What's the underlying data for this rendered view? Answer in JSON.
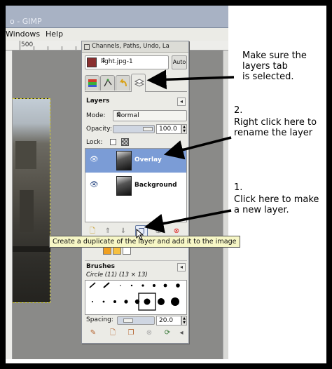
{
  "gimp_window": {
    "title": "o - GIMP",
    "menu": [
      "Windows",
      "Help"
    ],
    "ruler_mark": "500"
  },
  "dock": {
    "title": "Channels, Paths, Undo, La",
    "image_selector": "light.jpg-1",
    "auto_button": "Auto",
    "tabs": [
      "channels-tab",
      "paths-tab",
      "undo-tab",
      "layers-tab"
    ],
    "active_tab": "layers-tab",
    "panel_header": "Layers",
    "mode_label": "Mode:",
    "mode_value": "Normal",
    "opacity_label": "Opacity:",
    "opacity_value": "100.0",
    "lock_label": "Lock:",
    "layers": [
      {
        "name": "Overlay",
        "selected": true
      },
      {
        "name": "Background",
        "selected": false
      }
    ],
    "brushes_header": "Brushes",
    "brush_info": "Circle (11) (13 × 13)",
    "spacing_label": "Spacing:",
    "spacing_value": "20.0"
  },
  "tooltip": "Create a duplicate of the layer and add it to the image",
  "annotations": {
    "note_tab": [
      "Make sure the",
      "layers tab",
      "is selected."
    ],
    "note_rename_num": "2.",
    "note_rename": [
      "Right click here to",
      "rename the layer"
    ],
    "note_new_num": "1.",
    "note_new": [
      "Click here to make",
      "a new layer."
    ]
  },
  "colors": {
    "selection": "#7b9cd6",
    "tooltip_bg": "#f7f7c6",
    "arrow": "#000000",
    "frame": "#000000"
  }
}
